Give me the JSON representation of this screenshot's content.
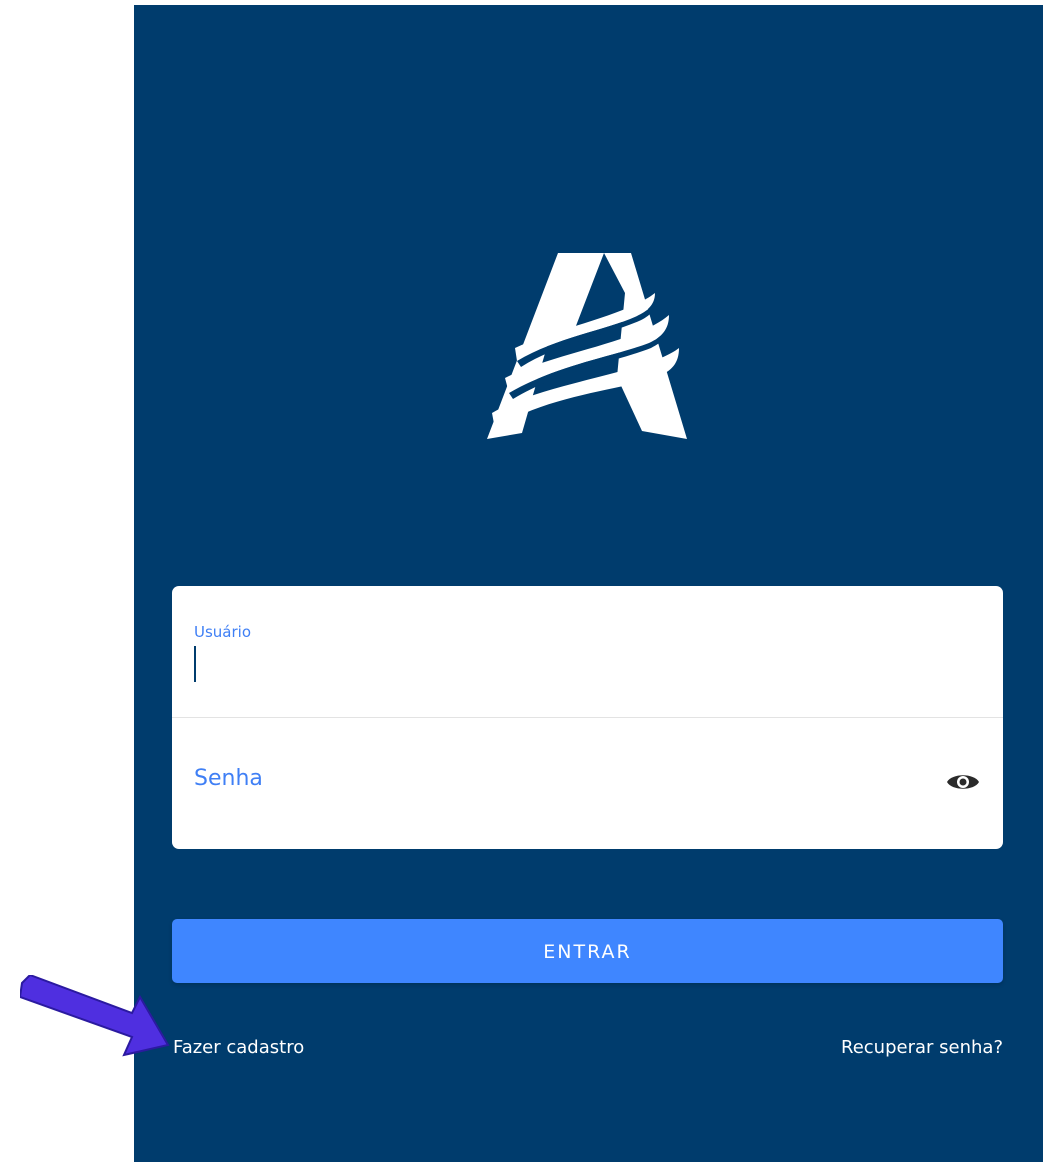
{
  "brand": {
    "logo_icon": "A-logo-icon",
    "panel_color": "#003c6d",
    "accent_color": "#3f86ff"
  },
  "login": {
    "username_label": "Usuário",
    "username_value": "",
    "password_label": "Senha",
    "password_value": "",
    "toggle_visibility_icon": "eye-icon"
  },
  "actions": {
    "submit_label": "ENTRAR",
    "register_link": "Fazer cadastro",
    "recover_link": "Recuperar senha?"
  },
  "annotation": {
    "arrow_icon": "arrow-pointer-icon",
    "arrow_color": "#4f2fe0"
  }
}
